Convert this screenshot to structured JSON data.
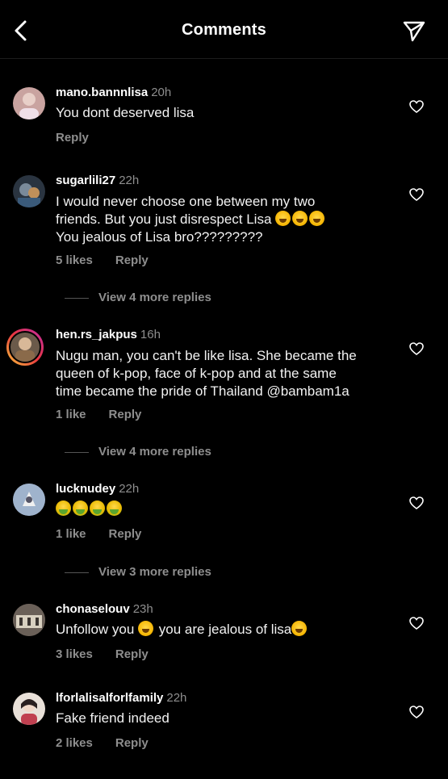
{
  "header": {
    "title": "Comments",
    "back_icon": "chevron-left-icon",
    "send_icon": "send-icon"
  },
  "comments": [
    {
      "user": "mano.bannnlisa",
      "time": "20h",
      "lines": [
        "You dont deserved lisa"
      ],
      "likes": "",
      "reply": "Reply",
      "avatar_color": "#c9a3a0"
    },
    {
      "user": "sugarlili27",
      "time": "22h",
      "lines": [
        "I would never choose one between my two",
        "friends. But you just disrespect Lisa",
        "You jealous of Lisa bro?????????"
      ],
      "likes": "5 likes",
      "reply": "Reply",
      "view_replies": "View 4 more replies",
      "avatar_color": "#3a4a5c"
    },
    {
      "user": "hen.rs_jakpus",
      "time": "16h",
      "lines": [
        "Nugu man, you can't be like lisa. She became the",
        "queen of k-pop, face of k-pop and at the same",
        "time became the pride of Thailand @bambam1a"
      ],
      "likes": "1 like",
      "reply": "Reply",
      "view_replies": "View 4 more replies",
      "avatar_color": "#6b5a4a"
    },
    {
      "user": "lucknudey",
      "time": "22h",
      "lines": [
        ""
      ],
      "likes": "1 like",
      "reply": "Reply",
      "view_replies": "View 3 more replies",
      "avatar_color": "#8fa3c0"
    },
    {
      "user": "chonaselouv",
      "time": "23h",
      "lines": [
        "Unfollow you",
        "you are jealous of lisa"
      ],
      "likes": "3 likes",
      "reply": "Reply",
      "avatar_color": "#5a5048"
    },
    {
      "user": "lforlalisalforlfamily",
      "time": "22h",
      "lines": [
        "Fake friend indeed"
      ],
      "likes": "2 likes",
      "reply": "Reply",
      "avatar_color": "#b8a8a0"
    }
  ]
}
